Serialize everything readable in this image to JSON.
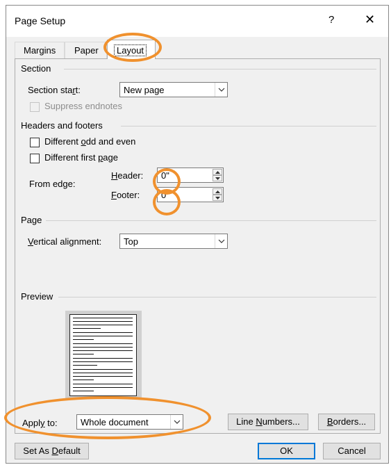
{
  "dialog": {
    "title": "Page Setup",
    "help_glyph": "?",
    "close_glyph": "✕"
  },
  "tabs": [
    {
      "label": "Margins",
      "active": false
    },
    {
      "label": "Paper",
      "active": false
    },
    {
      "label": "Layout",
      "active": true
    }
  ],
  "section": {
    "group_title": "Section",
    "section_start_label_pre": "Section sta",
    "section_start_label_u": "r",
    "section_start_label_post": "t:",
    "section_start_value": "New page",
    "suppress_endnotes_label": "Suppress endnotes",
    "suppress_endnotes_checked": false
  },
  "headers_footers": {
    "group_title": "Headers and footers",
    "diff_odd_even_pre": "Different ",
    "diff_odd_even_u": "o",
    "diff_odd_even_post": "dd and even",
    "diff_first_pre": "Different first ",
    "diff_first_u": "p",
    "diff_first_post": "age",
    "from_edge_label": "From edge:",
    "header_label_u": "H",
    "header_label_post": "eader:",
    "header_value": "0\"",
    "footer_label_u": "F",
    "footer_label_post": "ooter:",
    "footer_value": "0\""
  },
  "page": {
    "group_title": "Page",
    "valign_label_u": "V",
    "valign_label_post": "ertical alignment:",
    "valign_value": "Top"
  },
  "preview": {
    "group_title": "Preview"
  },
  "apply_to": {
    "label_pre": "Appl",
    "label_u": "y",
    "label_post": " to:",
    "value": "Whole document"
  },
  "buttons": {
    "line_numbers_pre": "Line ",
    "line_numbers_u": "N",
    "line_numbers_post": "umbers...",
    "borders_u": "B",
    "borders_post": "orders...",
    "set_default_pre": "Set As ",
    "set_default_u": "D",
    "set_default_post": "efault",
    "ok": "OK",
    "cancel": "Cancel"
  },
  "colors": {
    "highlight_ring": "#f0912e",
    "accent": "#0078d7"
  },
  "icons": {
    "dropdown": "chevron-down-icon",
    "spin_up": "triangle-up-icon",
    "spin_down": "triangle-down-icon",
    "close": "close-icon",
    "help": "help-icon"
  }
}
